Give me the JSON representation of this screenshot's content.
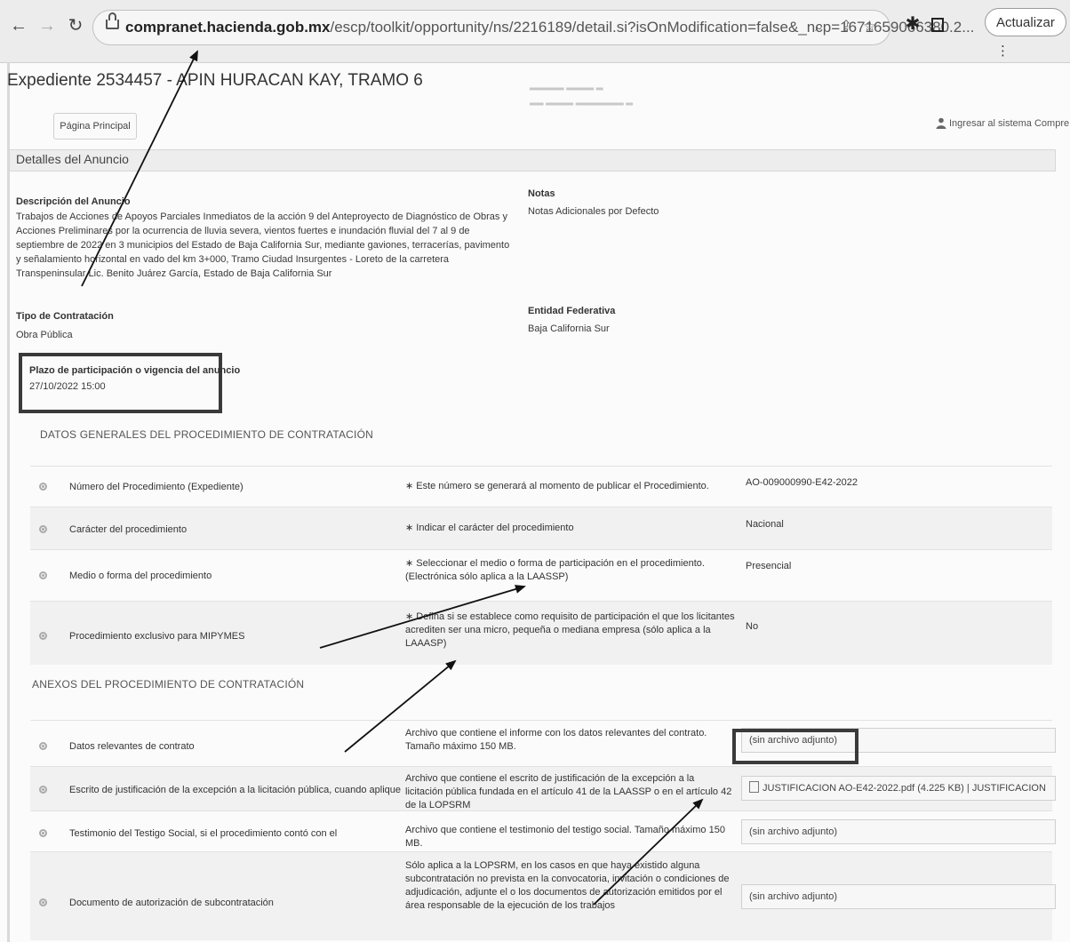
{
  "browser": {
    "url_host": "compranet.hacienda.gob.mx",
    "url_path": "/escp/toolkit/opportunity/ns/2216189/detail.si?isOnModification=false&_ncp=1671659066380.2...",
    "update_label": "Actualizar"
  },
  "header": {
    "title": "Expediente 2534457 - APIN HURACAN KAY, TRAMO 6",
    "home_label": "Página Principal",
    "login_label": "Ingresar al sistema CompreNe"
  },
  "section": {
    "title": "Detalles del Anuncio"
  },
  "details": {
    "description_label": "Descripción del Anuncio",
    "description_text": "Trabajos de Acciones de Apoyos Parciales Inmediatos de la acción 9 del Anteproyecto de Diagnóstico de Obras y Acciones Preliminares por la ocurrencia de lluvia severa, vientos fuertes e inundación fluvial del 7 al 9 de septiembre de 2022 en 3 municipios del Estado de Baja California Sur, mediante gaviones, terracerías, pavimento y señalamiento horizontal en vado del km 3+000, Tramo Ciudad Insurgentes - Loreto de la carretera Transpeninsular Lic. Benito Juárez García, Estado de Baja California Sur",
    "notes_label": "Notas",
    "notes_text": "Notas Adicionales por Defecto",
    "contract_type_label": "Tipo de Contratación",
    "contract_type_value": "Obra Pública",
    "state_label": "Entidad Federativa",
    "state_value": "Baja California Sur",
    "deadline_label": "Plazo de participación o vigencia del anuncio",
    "deadline_value": "27/10/2022 15:00"
  },
  "general": {
    "heading": "DATOS GENERALES DEL PROCEDIMIENTO DE CONTRATACIÓN",
    "rows": [
      {
        "label": "Número del Procedimiento (Expediente)",
        "note": "∗ Este número se generará al momento de publicar el Procedimiento.",
        "value": "AO-009000990-E42-2022"
      },
      {
        "label": "Carácter del procedimiento",
        "note": "∗ Indicar el carácter del procedimiento",
        "value": "Nacional"
      },
      {
        "label": "Medio o forma del procedimiento",
        "note": "∗ Seleccionar el medio o forma de participación en el procedimiento. (Electrónica sólo aplica a la LAASSP)",
        "value": "Presencial"
      },
      {
        "label": "Procedimiento exclusivo para MIPYMES",
        "note": "∗ Defina si se establece como requisito de participación el que los licitantes acrediten ser una micro, pequeña o mediana empresa (sólo aplica a la LAAASP)",
        "value": "No"
      }
    ]
  },
  "annexes": {
    "heading": "ANEXOS DEL PROCEDIMIENTO DE CONTRATACIÓN",
    "rows": [
      {
        "label": "Datos relevantes de contrato",
        "note": "Archivo que contiene el informe con los datos relevantes del contrato. Tamaño máximo 150 MB.",
        "value": "(sin archivo adjunto)"
      },
      {
        "label": "Escrito de justificación de la excepción a la licitación pública, cuando aplique",
        "note": "Archivo que contiene el escrito de justificación de la excepción a la licitación pública fundada en el artículo 41 de la LAASSP o en el artículo 42 de la LOPSRM",
        "file_name": "JUSTIFICACION AO-E42-2022.pdf",
        "file_size": "(4.225 KB)",
        "file_desc": "JUSTIFICACION"
      },
      {
        "label": "Testimonio del Testigo Social, si el procedimiento contó con el",
        "note": "Archivo que contiene el testimonio del testigo social. Tamaño máximo 150 MB.",
        "value": "(sin archivo adjunto)"
      },
      {
        "label": "Documento de autorización de subcontratación",
        "note": "Sólo aplica a la LOPSRM, en los casos en que haya existido alguna subcontratación no prevista en la convocatoria, invitación o condiciones de adjudicación, adjunte el o los documentos de autorización emitidos por el área responsable de la ejecución de los trabajos",
        "value": "(sin archivo adjunto)"
      }
    ]
  }
}
